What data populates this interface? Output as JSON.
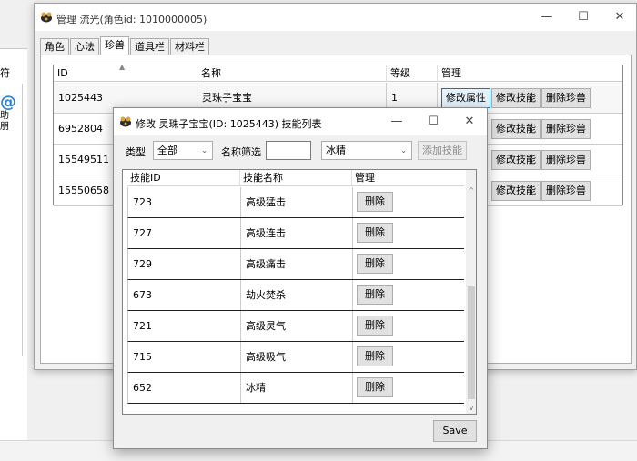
{
  "background": {
    "label_fu": "符",
    "at_icon": "@",
    "label_ming": "助朋"
  },
  "main_window": {
    "title": "管理 流光(角色id: 1010000005)",
    "tabs": [
      {
        "label": "角色"
      },
      {
        "label": "心法"
      },
      {
        "label": "珍兽",
        "active": true
      },
      {
        "label": "道具栏"
      },
      {
        "label": "材料栏"
      }
    ],
    "grid": {
      "columns": [
        "ID",
        "名称",
        "等级",
        "管理"
      ],
      "rows": [
        {
          "id": "1025443",
          "name": "灵珠子宝宝",
          "level": "1"
        },
        {
          "id": "6952804",
          "name": "",
          "level": ""
        },
        {
          "id": "15549511",
          "name": "",
          "level": ""
        },
        {
          "id": "15550658",
          "name": "",
          "level": ""
        }
      ],
      "actions": {
        "edit_attr": "修改属性",
        "edit_skill": "修改技能",
        "delete_pet": "删除珍兽"
      }
    }
  },
  "dialog": {
    "title": "修改 灵珠子宝宝(ID: 1025443) 技能列表",
    "filter": {
      "type_label": "类型",
      "type_value": "全部",
      "name_label": "名称筛选",
      "name_value": "",
      "skill_select": "冰精",
      "add_button": "添加技能"
    },
    "columns": [
      "技能ID",
      "技能名称",
      "管理"
    ],
    "rows": [
      {
        "id": "723",
        "name": "高级猛击"
      },
      {
        "id": "727",
        "name": "高级连击"
      },
      {
        "id": "729",
        "name": "高级痛击"
      },
      {
        "id": "673",
        "name": "劫火焚杀"
      },
      {
        "id": "721",
        "name": "高级灵气"
      },
      {
        "id": "715",
        "name": "高级吸气"
      },
      {
        "id": "652",
        "name": "冰精"
      }
    ],
    "delete_label": "删除",
    "save_label": "Save"
  },
  "controls": {
    "minimize": "—",
    "maximize": "☐",
    "close": "✕"
  }
}
